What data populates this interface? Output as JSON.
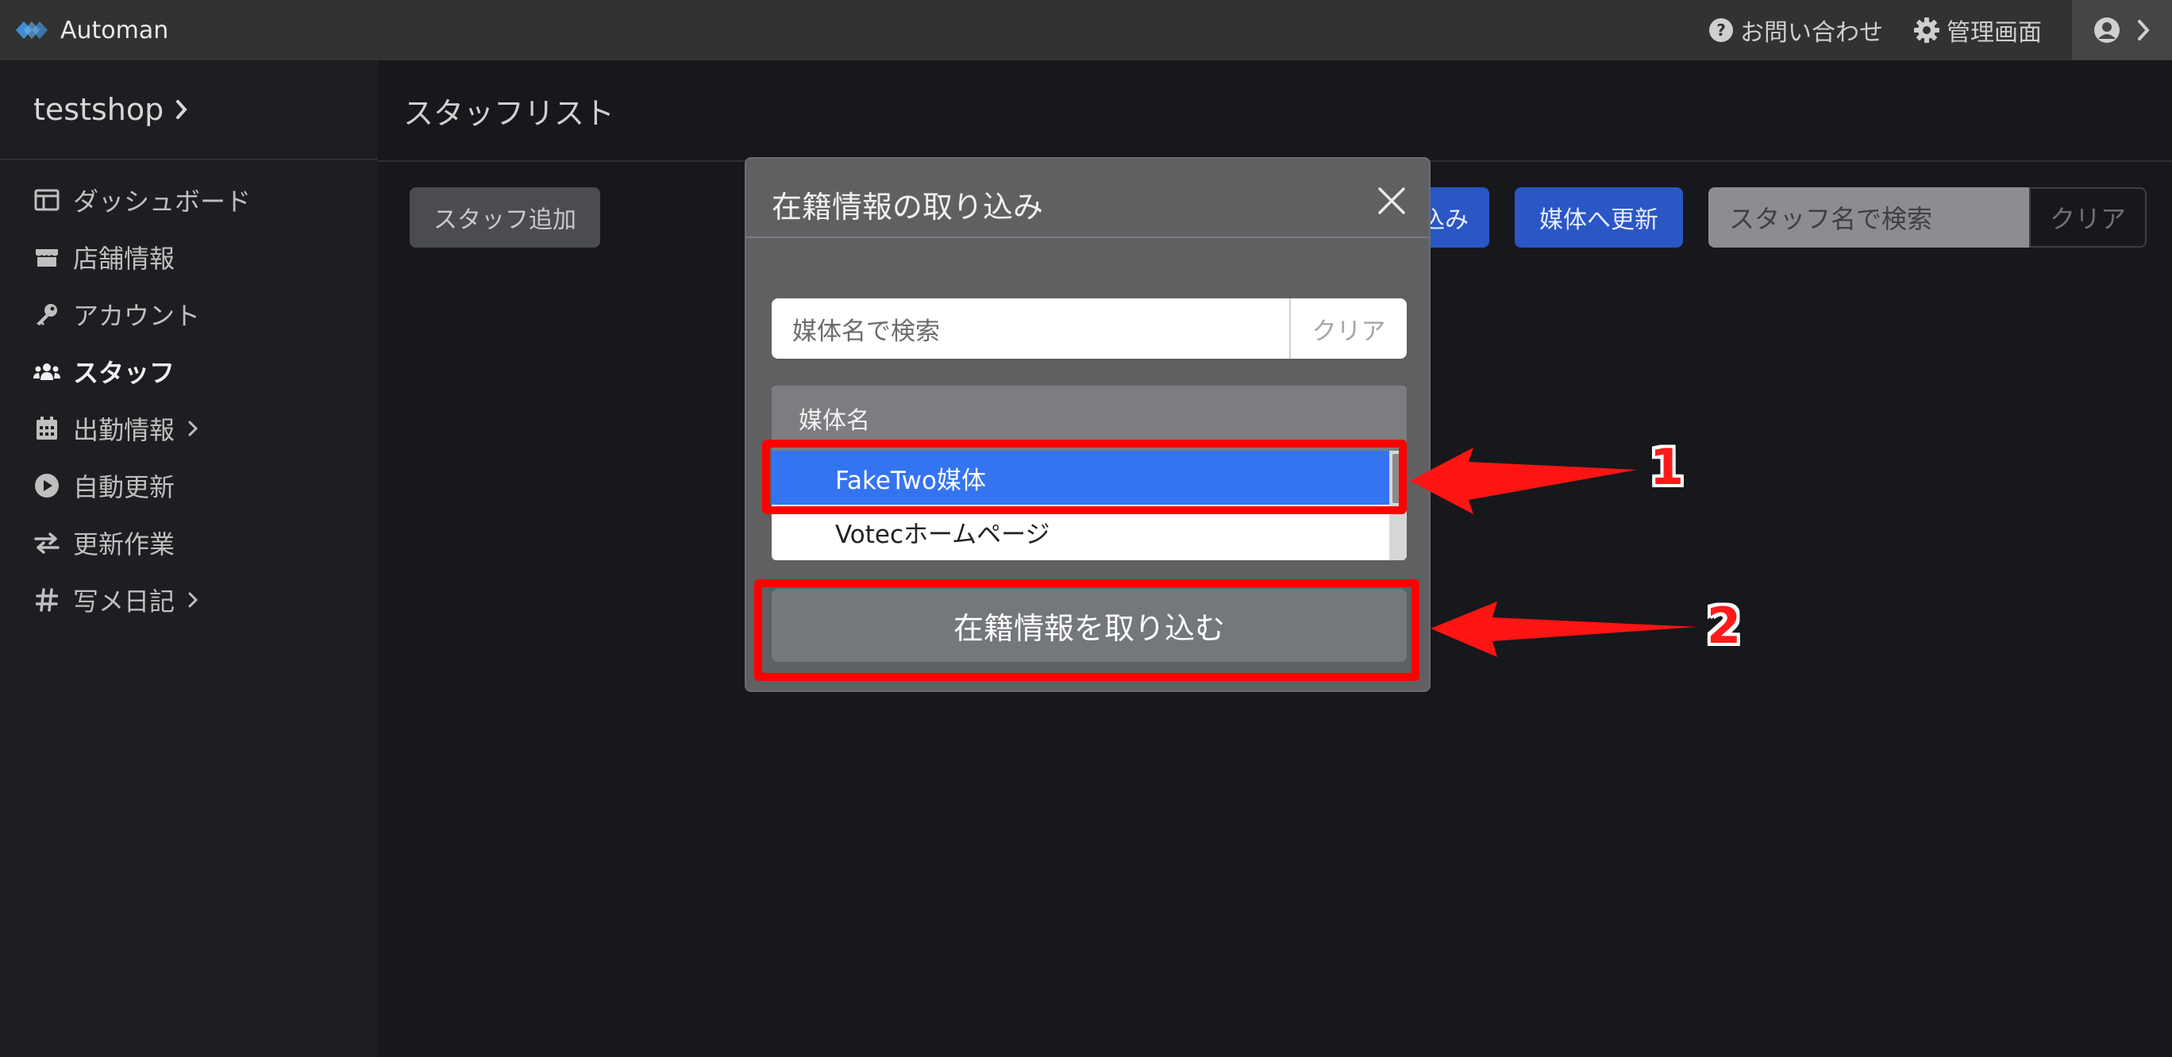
{
  "navbar": {
    "brand": "Automan",
    "contact_label": "お問い合わせ",
    "admin_label": "管理画面"
  },
  "sidebar": {
    "shop_name": "testshop",
    "items": [
      {
        "label": "ダッシュボード",
        "icon": "dashboard-icon"
      },
      {
        "label": "店舗情報",
        "icon": "store-icon"
      },
      {
        "label": "アカウント",
        "icon": "key-icon"
      },
      {
        "label": "スタッフ",
        "icon": "users-icon",
        "active": true
      },
      {
        "label": "出勤情報",
        "icon": "calendar-icon",
        "has_children": true
      },
      {
        "label": "自動更新",
        "icon": "play-circle-icon"
      },
      {
        "label": "更新作業",
        "icon": "exchange-icon"
      },
      {
        "label": "写メ日記",
        "icon": "hashtag-icon",
        "has_children": true
      }
    ]
  },
  "main": {
    "title": "スタッフリスト",
    "add_staff_label": "スタッフ追加",
    "import_partial_label": "込み",
    "update_media_label": "媒体へ更新",
    "search_placeholder": "スタッフ名で検索",
    "clear_label": "クリア"
  },
  "modal": {
    "title": "在籍情報の取り込み",
    "search_placeholder": "媒体名で検索",
    "clear_label": "クリア",
    "list_header": "媒体名",
    "rows": [
      {
        "label": "FakeTwo媒体",
        "selected": true
      },
      {
        "label": "Votecホームページ",
        "selected": false
      }
    ],
    "import_button_label": "在籍情報を取り込む"
  },
  "annotations": {
    "step1": "1",
    "step2": "2",
    "color": "#ff0000"
  },
  "colors": {
    "accent_blue": "#2a56c6",
    "selected_row": "#3574f0",
    "navbar_bg": "#323232",
    "sidebar_bg": "#1d1e21"
  }
}
